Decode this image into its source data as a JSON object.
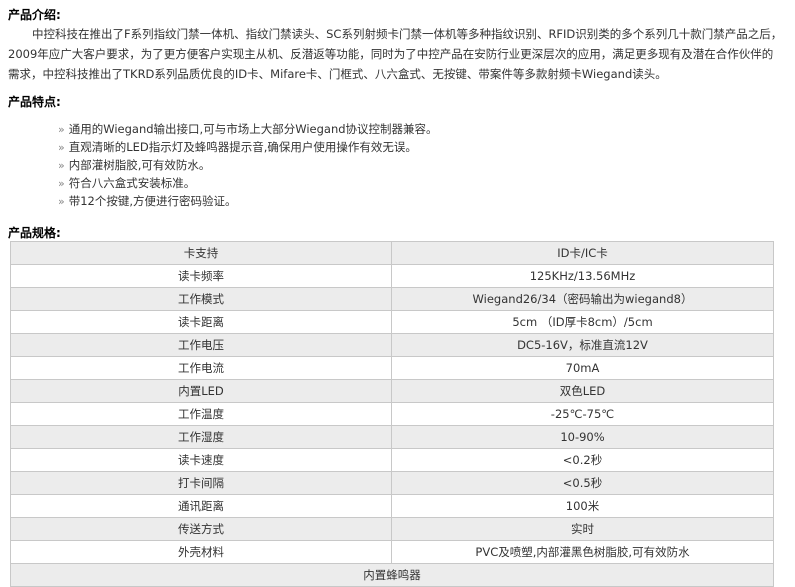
{
  "intro": {
    "heading": "产品介绍:",
    "text": "中控科技在推出了F系列指纹门禁一体机、指纹门禁读头、SC系列射频卡门禁一体机等多种指纹识别、RFID识别类的多个系列几十款门禁产品之后，2009年应广大客户要求，为了更方便客户实现主从机、反潜返等功能，同时为了中控产品在安防行业更深层次的应用，满足更多现有及潜在合作伙伴的需求，中控科技推出了TKRD系列品质优良的ID卡、Mifare卡、门框式、八六盒式、无按键、带案件等多款射频卡Wiegand读头。"
  },
  "features": {
    "heading": "产品特点:",
    "bullet": "»",
    "items": [
      "通用的Wiegand输出接口,可与市场上大部分Wiegand协议控制器兼容。",
      "直观清晰的LED指示灯及蜂鸣器提示音,确保用户使用操作有效无误。",
      "内部灌树脂胶,可有效防水。",
      "符合八六盒式安装标准。",
      "带12个按键,方便进行密码验证。"
    ]
  },
  "specs": {
    "heading": "产品规格:",
    "rows": [
      {
        "k": "卡支持",
        "v": "ID卡/IC卡"
      },
      {
        "k": "读卡频率",
        "v": "125KHz/13.56MHz"
      },
      {
        "k": "工作模式",
        "v": "Wiegand26/34（密码输出为wiegand8）"
      },
      {
        "k": "读卡距离",
        "v": "5cm （ID厚卡8cm）/5cm"
      },
      {
        "k": "工作电压",
        "v": "DC5-16V，标准直流12V"
      },
      {
        "k": "工作电流",
        "v": "70mA"
      },
      {
        "k": "内置LED",
        "v": "双色LED"
      },
      {
        "k": "工作温度",
        "v": "-25℃-75℃"
      },
      {
        "k": "工作湿度",
        "v": "10-90%"
      },
      {
        "k": "读卡速度",
        "v": "<0.2秒"
      },
      {
        "k": "打卡间隔",
        "v": "<0.5秒"
      },
      {
        "k": "通讯距离",
        "v": "100米"
      },
      {
        "k": "传送方式",
        "v": "实时"
      },
      {
        "k": "外壳材料",
        "v": "PVC及喷塑,内部灌黑色树脂胶,可有效防水"
      }
    ],
    "last_row": "内置蜂鸣器"
  }
}
